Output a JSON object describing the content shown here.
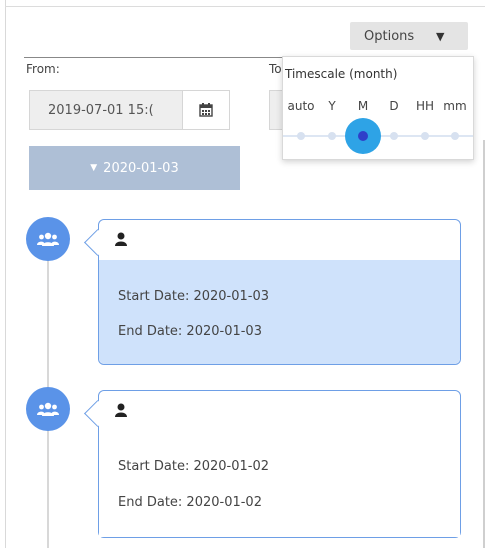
{
  "toolbar": {
    "options_label": "Options",
    "options_icon": "caret-down-icon"
  },
  "filters": {
    "from_label": "From:",
    "from_value": "2019-07-01 15:(",
    "to_label": "To",
    "calendar_icon": "calendar-icon"
  },
  "timescale_popup": {
    "title": "Timescale (month)",
    "scales": [
      "auto",
      "Y",
      "M",
      "D",
      "HH",
      "mm"
    ],
    "selected": "M"
  },
  "timeline": {
    "group_header": "2020-01-03",
    "group_icon": "caret-down-icon",
    "event_icon": "users-icon",
    "items": [
      {
        "user_icon": "user-icon",
        "start": "Start Date: 2020-01-03",
        "end": "End Date: 2020-01-03",
        "selected": true
      },
      {
        "user_icon": "user-icon",
        "start": "Start Date: 2020-01-02",
        "end": "End Date: 2020-01-02",
        "selected": false
      }
    ]
  },
  "colors": {
    "accent": "#5a93e8",
    "card_selected_bg": "#cfe2fb",
    "header_bg": "#aebfd6",
    "slider_knob": "#2ea3e6"
  }
}
